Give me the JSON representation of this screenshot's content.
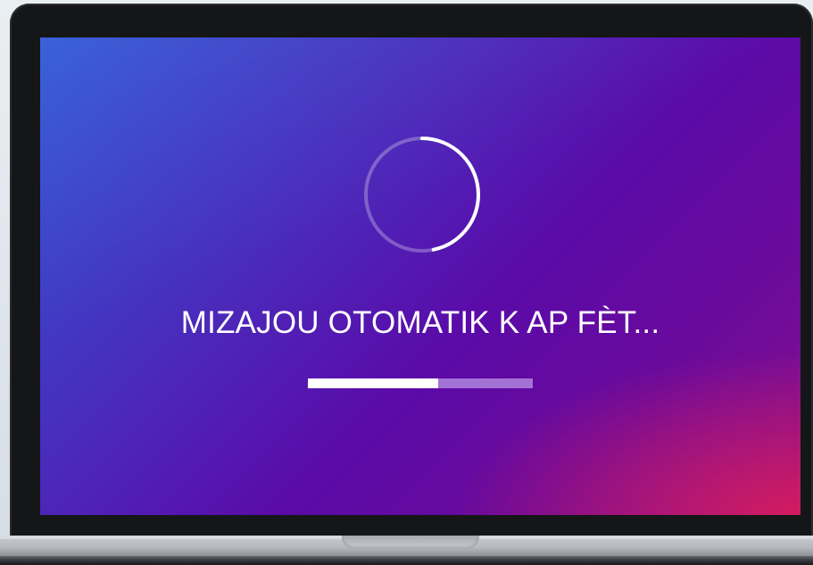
{
  "screen": {
    "message": "MIZAJOU OTOMATIK K AP FÈT...",
    "progress": 0.58,
    "spinner_icon": "loading-spinner-icon"
  },
  "colors": {
    "gradient_start": "#2d58d6",
    "gradient_mid": "#5b0aa8",
    "gradient_end": "#d61c5e",
    "progress_fill": "#ffffff",
    "progress_track": "#c8aaf0"
  }
}
